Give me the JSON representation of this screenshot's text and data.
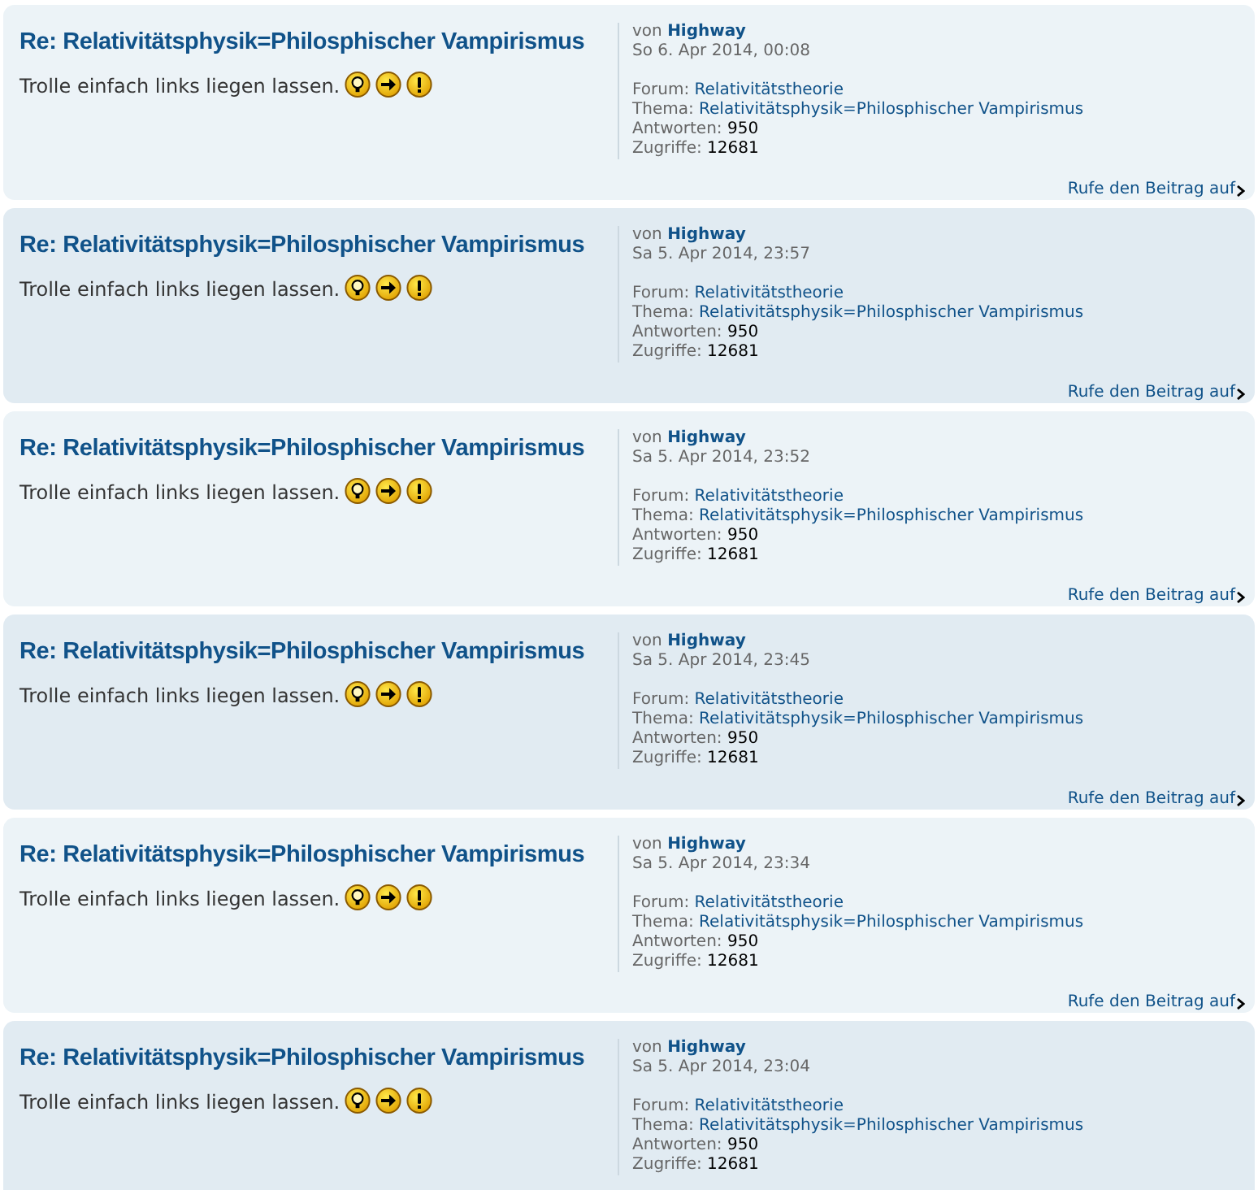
{
  "posts": [
    {
      "title": "Re: Relativitätsphysik=Philosphischer Vampirismus",
      "text": "Trolle einfach links liegen lassen.",
      "by_label": "von",
      "author": "Highway",
      "date": "So 6. Apr 2014, 00:08",
      "forum_label": "Forum:",
      "forum": "Relativitätstheorie",
      "topic_label": "Thema:",
      "topic": "Relativitätsphysik=Philosphischer Vampirismus",
      "replies_label": "Antworten:",
      "replies": "950",
      "views_label": "Zugriffe:",
      "views": "12681",
      "jump_link": "Rufe den Beitrag auf"
    },
    {
      "title": "Re: Relativitätsphysik=Philosphischer Vampirismus",
      "text": "Trolle einfach links liegen lassen.",
      "by_label": "von",
      "author": "Highway",
      "date": "Sa 5. Apr 2014, 23:57",
      "forum_label": "Forum:",
      "forum": "Relativitätstheorie",
      "topic_label": "Thema:",
      "topic": "Relativitätsphysik=Philosphischer Vampirismus",
      "replies_label": "Antworten:",
      "replies": "950",
      "views_label": "Zugriffe:",
      "views": "12681",
      "jump_link": "Rufe den Beitrag auf"
    },
    {
      "title": "Re: Relativitätsphysik=Philosphischer Vampirismus",
      "text": "Trolle einfach links liegen lassen.",
      "by_label": "von",
      "author": "Highway",
      "date": "Sa 5. Apr 2014, 23:52",
      "forum_label": "Forum:",
      "forum": "Relativitätstheorie",
      "topic_label": "Thema:",
      "topic": "Relativitätsphysik=Philosphischer Vampirismus",
      "replies_label": "Antworten:",
      "replies": "950",
      "views_label": "Zugriffe:",
      "views": "12681",
      "jump_link": "Rufe den Beitrag auf"
    },
    {
      "title": "Re: Relativitätsphysik=Philosphischer Vampirismus",
      "text": "Trolle einfach links liegen lassen.",
      "by_label": "von",
      "author": "Highway",
      "date": "Sa 5. Apr 2014, 23:45",
      "forum_label": "Forum:",
      "forum": "Relativitätstheorie",
      "topic_label": "Thema:",
      "topic": "Relativitätsphysik=Philosphischer Vampirismus",
      "replies_label": "Antworten:",
      "replies": "950",
      "views_label": "Zugriffe:",
      "views": "12681",
      "jump_link": "Rufe den Beitrag auf"
    },
    {
      "title": "Re: Relativitätsphysik=Philosphischer Vampirismus",
      "text": "Trolle einfach links liegen lassen.",
      "by_label": "von",
      "author": "Highway",
      "date": "Sa 5. Apr 2014, 23:34",
      "forum_label": "Forum:",
      "forum": "Relativitätstheorie",
      "topic_label": "Thema:",
      "topic": "Relativitätsphysik=Philosphischer Vampirismus",
      "replies_label": "Antworten:",
      "replies": "950",
      "views_label": "Zugriffe:",
      "views": "12681",
      "jump_link": "Rufe den Beitrag auf"
    },
    {
      "title": "Re: Relativitätsphysik=Philosphischer Vampirismus",
      "text": "Trolle einfach links liegen lassen.",
      "by_label": "von",
      "author": "Highway",
      "date": "Sa 5. Apr 2014, 23:04",
      "forum_label": "Forum:",
      "forum": "Relativitätstheorie",
      "topic_label": "Thema:",
      "topic": "Relativitätsphysik=Philosphischer Vampirismus",
      "replies_label": "Antworten:",
      "replies": "950",
      "views_label": "Zugriffe:",
      "views": "12681"
    }
  ]
}
